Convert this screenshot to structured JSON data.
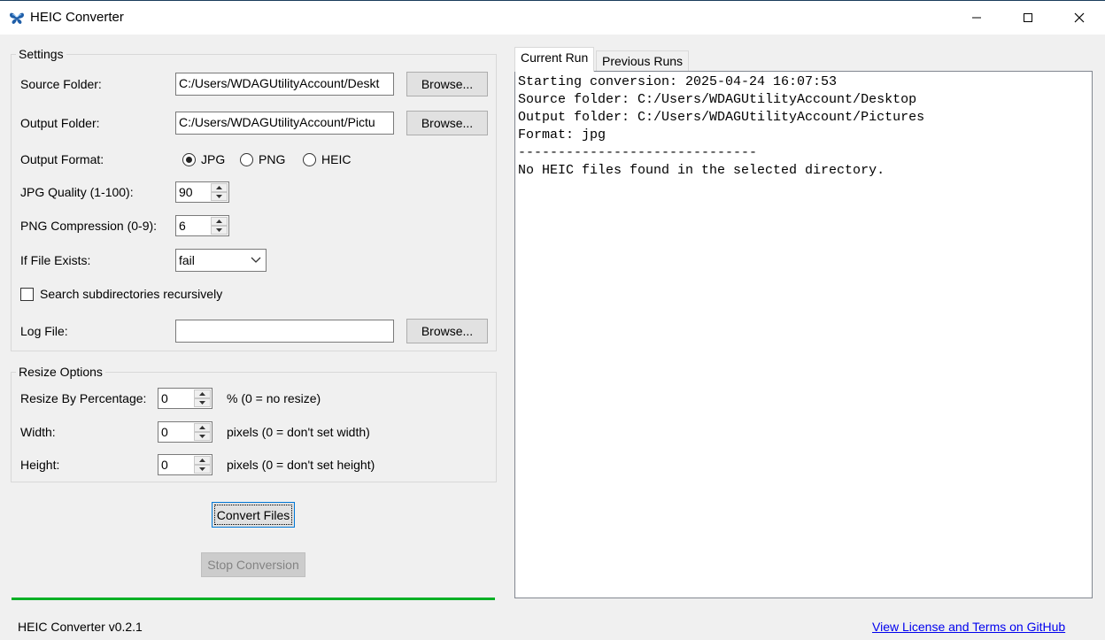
{
  "window": {
    "title": "HEIC Converter",
    "minimize_glyph": "—",
    "maximize_glyph": "☐",
    "close_glyph": "✕"
  },
  "settings": {
    "group_title": "Settings",
    "source_folder": {
      "label": "Source Folder:",
      "value": "C:/Users/WDAGUtilityAccount/Deskt",
      "browse": "Browse..."
    },
    "output_folder": {
      "label": "Output Folder:",
      "value": "C:/Users/WDAGUtilityAccount/Pictu",
      "browse": "Browse..."
    },
    "output_format": {
      "label": "Output Format:",
      "options": [
        "JPG",
        "PNG",
        "HEIC"
      ],
      "selected": "JPG"
    },
    "jpg_quality": {
      "label": "JPG Quality (1-100):",
      "value": "90"
    },
    "png_compression": {
      "label": "PNG Compression (0-9):",
      "value": "6"
    },
    "if_exists": {
      "label": "If File Exists:",
      "value": "fail"
    },
    "recursive": {
      "label": "Search subdirectories recursively",
      "checked": false
    },
    "log_file": {
      "label": "Log File:",
      "value": "",
      "browse": "Browse..."
    }
  },
  "resize": {
    "group_title": "Resize Options",
    "percentage": {
      "label": "Resize By Percentage:",
      "value": "0",
      "hint": "% (0 = no resize)"
    },
    "width": {
      "label": "Width:",
      "value": "0",
      "hint": "pixels (0 = don't set width)"
    },
    "height": {
      "label": "Height:",
      "value": "0",
      "hint": "pixels (0 = don't set height)"
    }
  },
  "actions": {
    "convert": "Convert Files",
    "stop": "Stop Conversion"
  },
  "progress": {
    "fraction": 1.0,
    "color": "#06b025"
  },
  "tabs": [
    {
      "label": "Current Run",
      "active": true
    },
    {
      "label": "Previous Runs",
      "active": false
    }
  ],
  "log": {
    "lines": [
      "Starting conversion: 2025-04-24 16:07:53",
      "Source folder: C:/Users/WDAGUtilityAccount/Desktop",
      "Output folder: C:/Users/WDAGUtilityAccount/Pictures",
      "Format: jpg",
      "------------------------------",
      "No HEIC files found in the selected directory."
    ]
  },
  "footer": {
    "version": "HEIC Converter v0.2.1",
    "license_link": "View License and Terms on GitHub"
  },
  "icons": {
    "app": "butterfly-icon",
    "chevron": "chevron-down-icon"
  }
}
